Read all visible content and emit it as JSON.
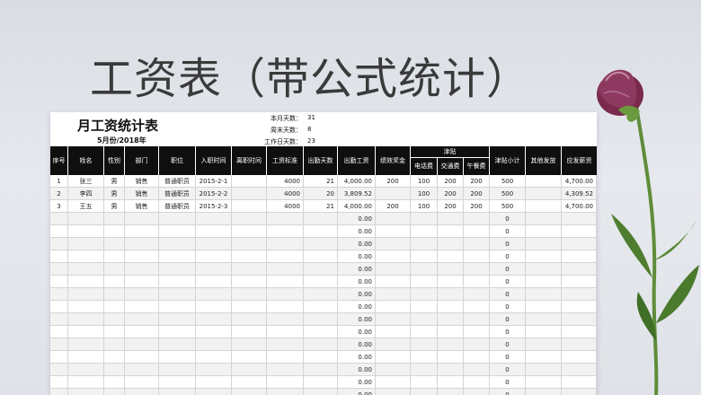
{
  "page_title": "工资表（带公式统计）",
  "sheet": {
    "title": "月工资统计表",
    "month": "5月份/2018年",
    "stats": [
      {
        "label": "本月天数：",
        "value": "31"
      },
      {
        "label": "周末天数：",
        "value": "8"
      },
      {
        "label": "工作日天数：",
        "value": "23"
      }
    ]
  },
  "headers": {
    "seq": "序号",
    "name": "姓名",
    "gender": "性别",
    "dept": "部门",
    "position": "职位",
    "hire_date": "入职时间",
    "leave_date": "离职时间",
    "salary_std": "工资标准",
    "attend_days": "出勤天数",
    "attend_pay": "出勤工资",
    "bonus": "绩效奖金",
    "allowance_group": "津贴",
    "phone": "电话费",
    "transport": "交通费",
    "lunch": "午餐费",
    "allowance_total": "津贴小计",
    "other": "其他发放",
    "total": "应发薪资"
  },
  "rows": [
    {
      "seq": "1",
      "name": "张三",
      "gender": "男",
      "dept": "销售",
      "position": "普通职员",
      "hire": "2015-2-1",
      "leave": "",
      "std": "4000",
      "days": "21",
      "pay": "4,000.00",
      "bonus": "200",
      "phone": "100",
      "transport": "200",
      "lunch": "200",
      "allow": "500",
      "other": "",
      "total": "4,700.00"
    },
    {
      "seq": "2",
      "name": "李四",
      "gender": "男",
      "dept": "销售",
      "position": "普通职员",
      "hire": "2015-2-2",
      "leave": "",
      "std": "4000",
      "days": "20",
      "pay": "3,809.52",
      "bonus": "",
      "phone": "100",
      "transport": "200",
      "lunch": "200",
      "allow": "500",
      "other": "",
      "total": "4,309.52"
    },
    {
      "seq": "3",
      "name": "王五",
      "gender": "男",
      "dept": "销售",
      "position": "普通职员",
      "hire": "2015-2-3",
      "leave": "",
      "std": "4000",
      "days": "21",
      "pay": "4,000.00",
      "bonus": "200",
      "phone": "100",
      "transport": "200",
      "lunch": "200",
      "allow": "500",
      "other": "",
      "total": "4,700.00"
    }
  ],
  "empty_row": {
    "pay": "0.00",
    "allow": "0"
  },
  "empty_row_count": 15,
  "colors": {
    "header_bg": "#0f0f0f",
    "title_text": "#3a3a3a",
    "stripe": "#f2f2f2"
  }
}
